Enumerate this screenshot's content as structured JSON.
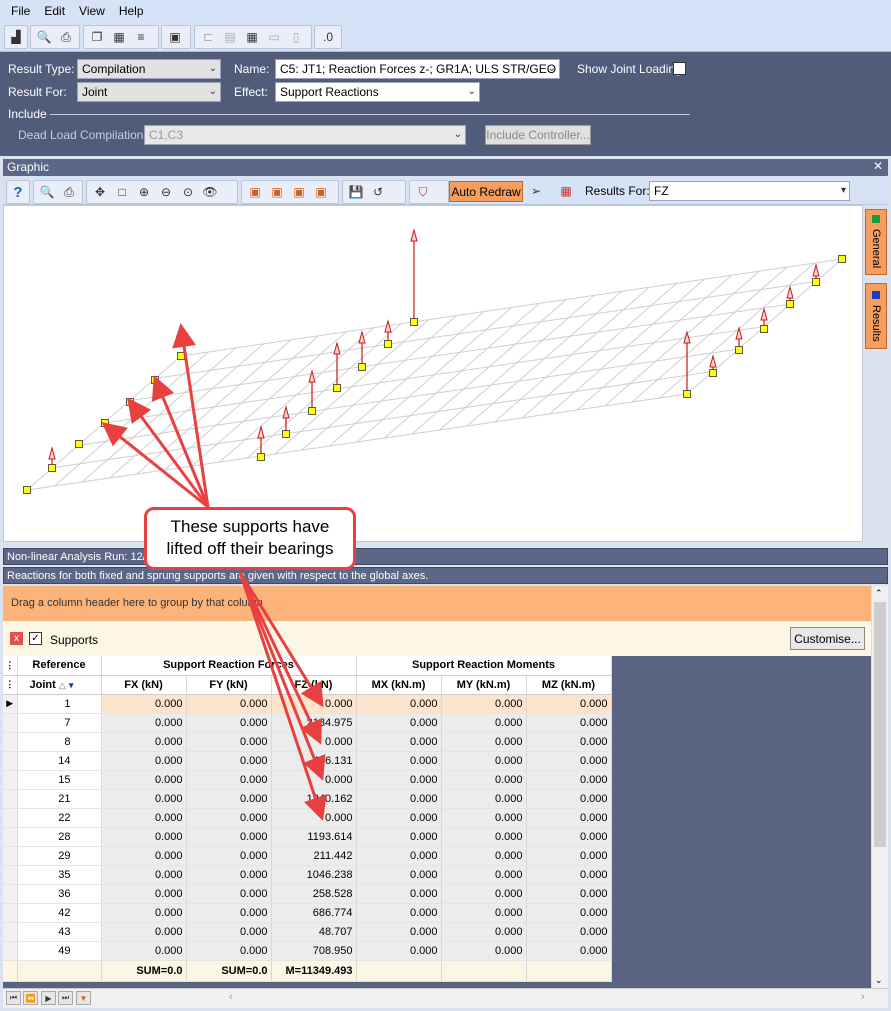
{
  "menu": [
    "File",
    "Edit",
    "View",
    "Help"
  ],
  "params": {
    "result_type_label": "Result Type:",
    "result_type_value": "Compilation",
    "name_label": "Name:",
    "name_value": "C5: JT1; Reaction Forces z-; GR1A; ULS STR/GEO",
    "show_joint_loading": "Show Joint Loading",
    "result_for_label": "Result For:",
    "result_for_value": "Joint",
    "effect_label": "Effect:",
    "effect_value": "Support Reactions",
    "include_label": "Include",
    "dead_load_label": "Dead Load Compilations:",
    "dead_load_value": "C1,C3",
    "include_controller": "Include Controller..."
  },
  "graphic": {
    "title": "Graphic",
    "auto_redraw": "Auto Redraw",
    "results_for_label": "Results For:",
    "results_for_value": "FZ"
  },
  "side_tabs": [
    "General",
    "Results"
  ],
  "info": {
    "line1": "Non-linear Analysis Run: 12/",
    "line2": "Reactions for both fixed and sprung supports are given with respect to the global axes."
  },
  "group_hint": "Drag a column header here to group by that column",
  "supports_label": "Supports",
  "customise": "Customise...",
  "table": {
    "group_headers": [
      "Reference",
      "Support Reaction Forces",
      "Support Reaction Moments"
    ],
    "columns": [
      "Joint",
      "FX (kN)",
      "FY (kN)",
      "FZ (kN)",
      "MX (kN.m)",
      "MY (kN.m)",
      "MZ (kN.m)"
    ],
    "rows": [
      [
        "1",
        "0.000",
        "0.000",
        "0.000",
        "0.000",
        "0.000",
        "0.000"
      ],
      [
        "7",
        "0.000",
        "0.000",
        "2184.975",
        "0.000",
        "0.000",
        "0.000"
      ],
      [
        "8",
        "0.000",
        "0.000",
        "0.000",
        "0.000",
        "0.000",
        "0.000"
      ],
      [
        "14",
        "0.000",
        "0.000",
        "446.131",
        "0.000",
        "0.000",
        "0.000"
      ],
      [
        "15",
        "0.000",
        "0.000",
        "0.000",
        "0.000",
        "0.000",
        "0.000"
      ],
      [
        "21",
        "0.000",
        "0.000",
        "1240.162",
        "0.000",
        "0.000",
        "0.000"
      ],
      [
        "22",
        "0.000",
        "0.000",
        "0.000",
        "0.000",
        "0.000",
        "0.000"
      ],
      [
        "28",
        "0.000",
        "0.000",
        "1193.614",
        "0.000",
        "0.000",
        "0.000"
      ],
      [
        "29",
        "0.000",
        "0.000",
        "211.442",
        "0.000",
        "0.000",
        "0.000"
      ],
      [
        "35",
        "0.000",
        "0.000",
        "1046.238",
        "0.000",
        "0.000",
        "0.000"
      ],
      [
        "36",
        "0.000",
        "0.000",
        "258.528",
        "0.000",
        "0.000",
        "0.000"
      ],
      [
        "42",
        "0.000",
        "0.000",
        "686.774",
        "0.000",
        "0.000",
        "0.000"
      ],
      [
        "43",
        "0.000",
        "0.000",
        "48.707",
        "0.000",
        "0.000",
        "0.000"
      ],
      [
        "49",
        "0.000",
        "0.000",
        "708.950",
        "0.000",
        "0.000",
        "0.000"
      ]
    ],
    "footer": [
      "SUM=0.0",
      "SUM=0.0",
      "M=11349.493"
    ]
  },
  "callout": {
    "line1": "These supports have",
    "line2": "lifted off their bearings"
  },
  "colors": {
    "accent": "#f59e5e",
    "panel": "#515b7a",
    "arrow": "#e84040"
  }
}
